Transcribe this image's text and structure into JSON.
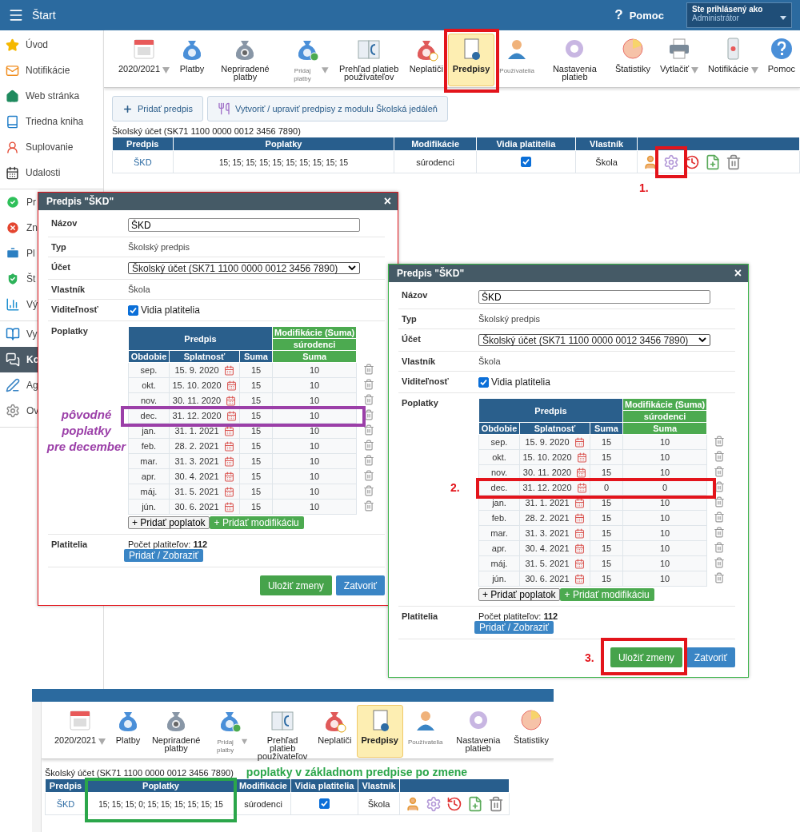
{
  "topbar": {
    "title": "Štart",
    "help_icon": "?",
    "help": "Pomoc",
    "user_label": "Ste prihlásený ako",
    "user_value": "Administrátor"
  },
  "sidebar": {
    "groups": [
      [
        {
          "label": "Úvod",
          "selected": false
        },
        {
          "label": "Notifikácie",
          "selected": false
        },
        {
          "label": "Web stránka",
          "selected": false
        },
        {
          "label": "Triedna kniha",
          "selected": false
        },
        {
          "label": "Suplovanie",
          "selected": false
        },
        {
          "label": "Udalosti",
          "selected": false
        }
      ],
      [
        {
          "label": "Pr",
          "selected": false
        },
        {
          "label": "Zn",
          "selected": false
        },
        {
          "label": "Pl",
          "selected": false
        },
        {
          "label": "Št",
          "selected": false
        },
        {
          "label": "Vý",
          "selected": false
        }
      ],
      [
        {
          "label": "Vy",
          "selected": false
        },
        {
          "label": "Ko",
          "selected": true
        },
        {
          "label": "Ag",
          "selected": false
        },
        {
          "label": "Ov",
          "selected": false
        }
      ]
    ]
  },
  "toolbar": {
    "items": [
      {
        "label": "2020/2021",
        "kind": "normal",
        "dropdown": true,
        "selected": false,
        "marked": false
      },
      {
        "label": "Platby",
        "kind": "normal",
        "dropdown": false,
        "selected": false,
        "marked": false
      },
      {
        "label": "Nepriradené platby",
        "kind": "normal",
        "dropdown": false,
        "selected": false,
        "marked": false
      },
      {
        "label": "Pridaj platby",
        "kind": "minor",
        "dropdown": true,
        "selected": false,
        "marked": false
      },
      {
        "label": "Prehľad platieb používateľov",
        "kind": "normal",
        "dropdown": false,
        "selected": false,
        "marked": false
      },
      {
        "label": "Neplatiči",
        "kind": "normal",
        "dropdown": false,
        "selected": false,
        "marked": false
      },
      {
        "label": "Predpisy",
        "kind": "normal",
        "dropdown": false,
        "selected": true,
        "marked": true
      },
      {
        "label": "Používatelia",
        "kind": "minor",
        "dropdown": false,
        "selected": false,
        "marked": false
      },
      {
        "label": "Nastavenia platieb",
        "kind": "normal",
        "dropdown": false,
        "selected": false,
        "marked": false
      },
      {
        "label": "Štatistiky",
        "kind": "normal",
        "dropdown": false,
        "selected": false,
        "marked": false
      },
      {
        "label": "Vytlačiť",
        "kind": "normal",
        "dropdown": true,
        "selected": false,
        "marked": false
      },
      {
        "label": "Notifikácie",
        "kind": "normal",
        "dropdown": true,
        "selected": false,
        "marked": false
      },
      {
        "label": "Pomoc",
        "kind": "normal",
        "dropdown": false,
        "selected": false,
        "marked": false
      }
    ]
  },
  "actions": [
    {
      "label": "Pridať predpis"
    },
    {
      "label": "Vytvoriť / upraviť predpisy z modulu Školská jedáleň"
    }
  ],
  "account": "Školský účet (SK71 1100 0000 0012 3456 7890)",
  "table": {
    "columns": [
      {
        "label": "Predpis",
        "marked": false
      },
      {
        "label": "Poplatky",
        "marked": false
      },
      {
        "label": "Modifikácie",
        "marked": false
      },
      {
        "label": "Vidia platitelia",
        "marked": false
      },
      {
        "label": "Vlastník",
        "marked": false
      }
    ],
    "rows": [
      {
        "name": "ŠKD",
        "fees": "15; 15; 15; 15; 15; 15; 15; 15; 15; 15",
        "modification": "súrodenci",
        "visible": true,
        "owner": "Škola",
        "actions": [
          {
            "marked": false
          },
          {
            "marked": true,
            "marker": "1."
          },
          {
            "marked": false
          },
          {
            "marked": false
          },
          {
            "marked": false
          }
        ]
      }
    ]
  },
  "dialogs": [
    {
      "title": "Predpis \"ŠKD\"",
      "close": "×",
      "name_label": "Názov",
      "name": "ŠKD",
      "type_label": "Typ",
      "type": "Školský predpis",
      "account_label": "Účet",
      "account": "Školský účet (SK71 1100 0000 0012 3456 7890)",
      "owner_label": "Vlastník",
      "owner": "Škola",
      "visibility_label": "Viditeľnosť",
      "visibility": "Vidia platitelia",
      "visible": true,
      "fees_label": "Poplatky",
      "fee_headers": {
        "main": "Predpis",
        "mod": "Modifikácie (Suma)",
        "mod_name": "súrodenci",
        "period": "Obdobie",
        "due": "Splatnosť",
        "amount": "Suma",
        "mod_amount": "Suma"
      },
      "fees": [
        {
          "period": "sep.",
          "due": "15. 9. 2020",
          "amount": "15",
          "mod": "10",
          "marked": false
        },
        {
          "period": "okt.",
          "due": "15. 10. 2020",
          "amount": "15",
          "mod": "10",
          "marked": false
        },
        {
          "period": "nov.",
          "due": "30. 11. 2020",
          "amount": "15",
          "mod": "10",
          "marked": false
        },
        {
          "period": "dec.",
          "due": "31. 12. 2020",
          "amount": "15",
          "mod": "10",
          "marked": true
        },
        {
          "period": "jan.",
          "due": "31. 1. 2021",
          "amount": "15",
          "mod": "10",
          "marked": false
        },
        {
          "period": "feb.",
          "due": "28. 2. 2021",
          "amount": "15",
          "mod": "10",
          "marked": false
        },
        {
          "period": "mar.",
          "due": "31. 3. 2021",
          "amount": "15",
          "mod": "10",
          "marked": false
        },
        {
          "period": "apr.",
          "due": "30. 4. 2021",
          "amount": "15",
          "mod": "10",
          "marked": false
        },
        {
          "period": "máj.",
          "due": "31. 5. 2021",
          "amount": "15",
          "mod": "10",
          "marked": false
        },
        {
          "period": "jún.",
          "due": "30. 6. 2021",
          "amount": "15",
          "mod": "10",
          "marked": false
        }
      ],
      "add_fee": "+ Pridať poplatok",
      "add_mod": "+ Pridať modifikáciu",
      "payers_label": "Platitelia",
      "payers": "Počet platiteľov: **112**",
      "payers_button": "Pridať / Zobraziť",
      "save": "Uložiť zmeny",
      "save_marked": false,
      "cancel": "Zatvoriť",
      "note": "pôvodné\npoplatky\npre december"
    },
    {
      "title": "Predpis \"ŠKD\"",
      "close": "×",
      "name_label": "Názov",
      "name": "ŠKD",
      "type_label": "Typ",
      "type": "Školský predpis",
      "account_label": "Účet",
      "account": "Školský účet (SK71 1100 0000 0012 3456 7890)",
      "owner_label": "Vlastník",
      "owner": "Škola",
      "visibility_label": "Viditeľnosť",
      "visibility": "Vidia platitelia",
      "visible": true,
      "fees_label": "Poplatky",
      "fee_headers": {
        "main": "Predpis",
        "mod": "Modifikácie (Suma)",
        "mod_name": "súrodenci",
        "period": "Obdobie",
        "due": "Splatnosť",
        "amount": "Suma",
        "mod_amount": "Suma"
      },
      "fees": [
        {
          "period": "sep.",
          "due": "15. 9. 2020",
          "amount": "15",
          "mod": "10",
          "marked": false
        },
        {
          "period": "okt.",
          "due": "15. 10. 2020",
          "amount": "15",
          "mod": "10",
          "marked": false
        },
        {
          "period": "nov.",
          "due": "30. 11. 2020",
          "amount": "15",
          "mod": "10",
          "marked": false
        },
        {
          "period": "dec.",
          "due": "31. 12. 2020",
          "amount": "0",
          "mod": "0",
          "marked": true,
          "marker": "2."
        },
        {
          "period": "jan.",
          "due": "31. 1. 2021",
          "amount": "15",
          "mod": "10",
          "marked": false
        },
        {
          "period": "feb.",
          "due": "28. 2. 2021",
          "amount": "15",
          "mod": "10",
          "marked": false
        },
        {
          "period": "mar.",
          "due": "31. 3. 2021",
          "amount": "15",
          "mod": "10",
          "marked": false
        },
        {
          "period": "apr.",
          "due": "30. 4. 2021",
          "amount": "15",
          "mod": "10",
          "marked": false
        },
        {
          "period": "máj.",
          "due": "31. 5. 2021",
          "amount": "15",
          "mod": "10",
          "marked": false
        },
        {
          "period": "jún.",
          "due": "30. 6. 2021",
          "amount": "15",
          "mod": "10",
          "marked": false
        }
      ],
      "add_fee": "+ Pridať poplatok",
      "add_mod": "+ Pridať modifikáciu",
      "payers_label": "Platitelia",
      "payers": "Počet platiteľov: **112**",
      "payers_button": "Pridať / Zobraziť",
      "save": "Uložiť zmeny",
      "save_marked": true,
      "save_marker": "3.",
      "cancel": "Zatvoriť"
    }
  ],
  "after": {
    "toolbar": {
      "items": [
        {
          "label": "2020/2021",
          "kind": "normal",
          "dropdown": true,
          "selected": false,
          "marked": false
        },
        {
          "label": "Platby",
          "kind": "normal",
          "dropdown": false,
          "selected": false,
          "marked": false
        },
        {
          "label": "Nepriradené platby",
          "kind": "normal",
          "dropdown": false,
          "selected": false,
          "marked": false
        },
        {
          "label": "Pridaj platby",
          "kind": "minor",
          "dropdown": true,
          "selected": false,
          "marked": false
        },
        {
          "label": "Prehľad platieb používateľov",
          "kind": "normal",
          "dropdown": false,
          "selected": false,
          "marked": false
        },
        {
          "label": "Neplatiči",
          "kind": "normal",
          "dropdown": false,
          "selected": false,
          "marked": false
        },
        {
          "label": "Predpisy",
          "kind": "normal",
          "dropdown": false,
          "selected": true,
          "marked": false
        },
        {
          "label": "Používatelia",
          "kind": "minor",
          "dropdown": false,
          "selected": false,
          "marked": false
        },
        {
          "label": "Nastavenia platieb",
          "kind": "normal",
          "dropdown": false,
          "selected": false,
          "marked": false
        },
        {
          "label": "Štatistiky",
          "kind": "normal",
          "dropdown": false,
          "selected": false,
          "marked": false
        }
      ]
    },
    "account": "Školský účet (SK71 1100 0000 0012 3456 7890)",
    "note": "poplatky v základnom predpise po zmene",
    "table": {
      "columns": [
        {
          "label": "Predpis",
          "marked": false
        },
        {
          "label": "Poplatky",
          "marked": true
        },
        {
          "label": "Modifikácie",
          "marked": false
        },
        {
          "label": "Vidia platitelia",
          "marked": false
        },
        {
          "label": "Vlastník",
          "marked": false
        }
      ],
      "rows": [
        {
          "name": "ŠKD",
          "fees": "15; 15; 15; 0; 15; 15; 15; 15; 15; 15",
          "modification": "súrodenci",
          "visible": true,
          "owner": "Škola",
          "actions": [
            {
              "marked": false
            },
            {
              "marked": false
            },
            {
              "marked": false
            },
            {
              "marked": false
            },
            {
              "marked": false
            }
          ]
        }
      ]
    }
  }
}
